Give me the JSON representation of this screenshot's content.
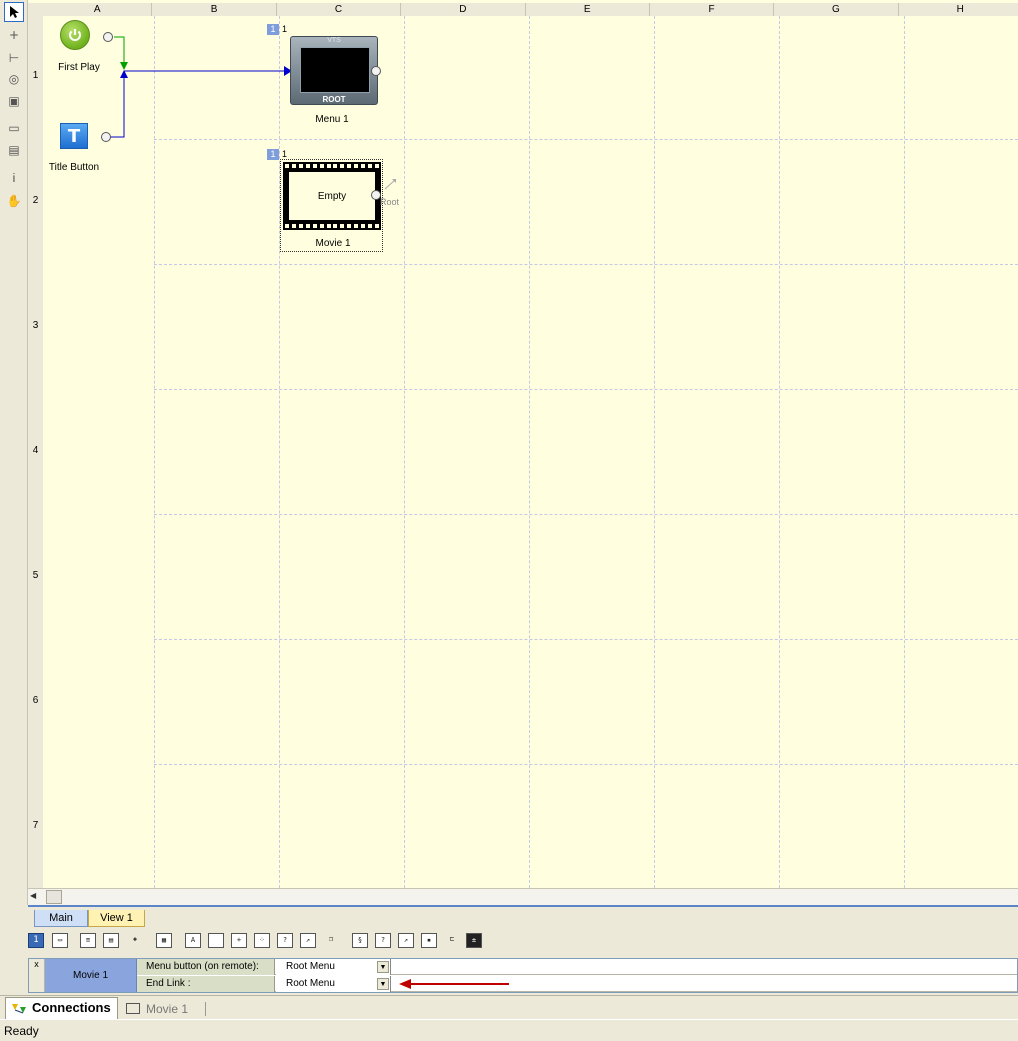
{
  "grid": {
    "columns": [
      "A",
      "B",
      "C",
      "D",
      "E",
      "F",
      "G",
      "H"
    ],
    "rows": [
      "1",
      "2",
      "3",
      "4",
      "5",
      "6",
      "7"
    ]
  },
  "nodes": {
    "first_play": {
      "label": "First Play"
    },
    "title_button": {
      "label": "Title Button",
      "icon_letter": "T"
    },
    "menu1": {
      "label": "Menu 1",
      "badge": "1",
      "number": "1",
      "top_text": "VTS",
      "bottom_text": "ROOT"
    },
    "movie1": {
      "label": "Movie 1",
      "badge": "1",
      "number": "1",
      "content": "Empty",
      "link_text": "Root"
    }
  },
  "tabs": {
    "main": "Main",
    "view1": "View 1"
  },
  "toolbar": {
    "selected": "1"
  },
  "properties": {
    "object": "Movie 1",
    "close": "x",
    "rows": [
      {
        "label": "Menu button (on remote):",
        "value": "Root Menu"
      },
      {
        "label": "End Link :",
        "value": "Root Menu"
      }
    ]
  },
  "doc_tabs": {
    "connections": "Connections",
    "movie": "Movie 1"
  },
  "status": "Ready",
  "colors": {
    "arrow_red": "#c00000",
    "link_blue": "#0000cc",
    "link_green": "#00a000"
  }
}
